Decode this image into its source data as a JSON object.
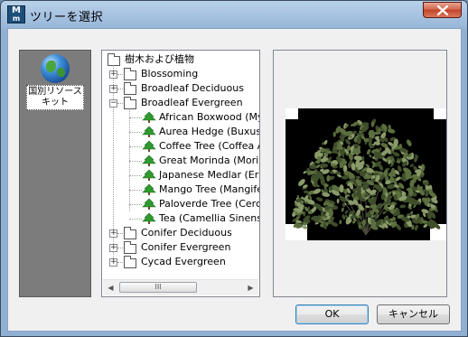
{
  "window": {
    "title": "ツリーを選択",
    "app_icon_top": "M",
    "app_icon_bottom": "m"
  },
  "kit": {
    "label_line1": "国別リソース",
    "label_line2": "キット",
    "icon": "globe-icon"
  },
  "tree": {
    "root": {
      "label": "樹木および植物",
      "icon": "folder-icon"
    },
    "items": [
      {
        "label": "Blossoming",
        "expander": "+",
        "icon": "folder-icon"
      },
      {
        "label": "Broadleaf Deciduous",
        "expander": "+",
        "icon": "folder-icon"
      },
      {
        "label": "Broadleaf Evergreen",
        "expander": "−",
        "icon": "folder-icon"
      },
      {
        "label": "African Boxwood (Myrs",
        "icon": "tree-icon"
      },
      {
        "label": "Aurea Hedge (Buxus Se",
        "icon": "tree-icon"
      },
      {
        "label": "Coffee Tree (Coffea Ar",
        "icon": "tree-icon"
      },
      {
        "label": "Great Morinda (Morinda",
        "icon": "tree-icon"
      },
      {
        "label": "Japanese Medlar (Eriob",
        "icon": "tree-icon"
      },
      {
        "label": "Mango Tree (Mangifera",
        "icon": "tree-icon"
      },
      {
        "label": "Paloverde Tree (Cercid",
        "icon": "tree-icon"
      },
      {
        "label": "Tea (Camellia Sinensis)",
        "icon": "tree-icon"
      },
      {
        "label": "Conifer Deciduous",
        "expander": "+",
        "icon": "folder-icon"
      },
      {
        "label": "Conifer Evergreen",
        "expander": "+",
        "icon": "folder-icon"
      },
      {
        "label": "Cycad Evergreen",
        "expander": "+",
        "icon": "folder-icon"
      }
    ],
    "scrollbar": {
      "left_arrow": "◀",
      "right_arrow": "▶",
      "thumb_grip": "III"
    }
  },
  "buttons": {
    "ok": "OK",
    "cancel": "キャンセル"
  },
  "colors": {
    "plant_green": "#5b6e3e",
    "tree_icon_green": "#2f9b2f"
  }
}
